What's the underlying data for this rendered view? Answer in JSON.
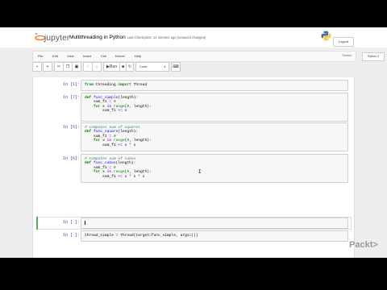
{
  "app": {
    "logo_text": "jupyter",
    "notebook_title": "Multithreading in Python",
    "checkpoint": "Last Checkpoint: 14 minutes ago  (unsaved changes)",
    "logout_label": "Logout"
  },
  "menu": {
    "items": [
      "File",
      "Edit",
      "View",
      "Insert",
      "Cell",
      "Kernel",
      "Help"
    ],
    "trusted": "Trusted",
    "kernel": "Python 3"
  },
  "toolbar": {
    "run_label": "Run",
    "cell_type": "Code"
  },
  "cells": [
    {
      "prompt": "In [1]:",
      "lines": [
        "from threading import Thread"
      ]
    },
    {
      "prompt": "In [7]:",
      "lines": [
        "def func_simple(length):",
        "    sum_f1 = 0",
        "    for x in range(0, length):",
        "        sum_f1 += x"
      ]
    },
    {
      "prompt": "In [5]:",
      "lines": [
        "# computes sum of squares",
        "def func_square(length):",
        "    sum_f1 = 0",
        "    for x in range(0, length):",
        "        sum_f1 += x * x"
      ]
    },
    {
      "prompt": "In [6]:",
      "lines": [
        "# computes sum of cubes",
        "def func_cubes(length):",
        "    sum_f1 = 0",
        "    for x in range(0, length):",
        "        sum_f1 += x * x * x"
      ]
    },
    {
      "prompt": "In [ ]:",
      "lines": [
        ""
      ]
    },
    {
      "prompt": "In [ ]:",
      "lines": [
        "thread_simple = Thread(target=func_simple, args=())"
      ]
    }
  ],
  "brand": "Packt>",
  "colors": {
    "selected_bar": "#4caf50",
    "prompt": "#303f9f"
  }
}
